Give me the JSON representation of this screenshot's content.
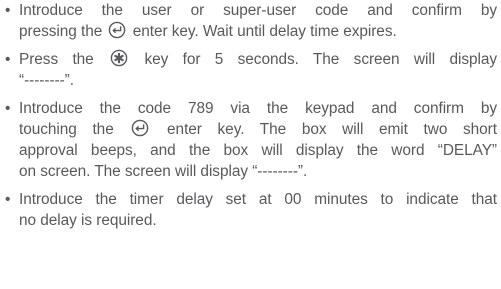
{
  "bullet_glyph": "•",
  "items": [
    {
      "a": "Introduce the user or super-user code and confirm by",
      "b1": "pressing the",
      "b2": "enter key. Wait until delay time expires."
    },
    {
      "a1": "Press the",
      "a2": "key for 5 seconds. The screen will display",
      "b": "“--------”."
    },
    {
      "a": "Introduce the code 789 via the keypad and confirm by",
      "b1": "touching the",
      "b2": "enter key. The box will emit two short",
      "c": "approval beeps, and the box will display the word “DELAY”",
      "d": "on screen. The screen will display “--------”."
    },
    {
      "a": "Introduce the timer delay set at 00 minutes to indicate that",
      "b": "no delay is required."
    }
  ],
  "icons": {
    "enter": "enter-key-icon",
    "star": "star-key-icon"
  }
}
